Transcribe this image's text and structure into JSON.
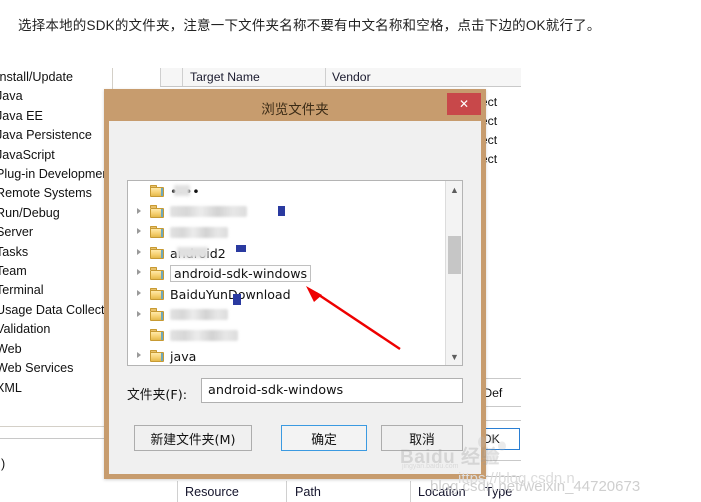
{
  "article": {
    "paragraph": "选择本地的SDK的文件夹，注意一下文件夹名称不要有中文名称和空格，点击下边的OK就行了。"
  },
  "eclipse": {
    "sidebar_items": [
      "Install/Update",
      "Java",
      "Java EE",
      "Java Persistence",
      "JavaScript",
      "Plug-in Development",
      "Remote Systems",
      "Run/Debug",
      "Server",
      "Tasks",
      "Team",
      "Terminal",
      "Usage Data Collector",
      "Validation",
      "Web",
      "Web Services",
      "XML"
    ],
    "sidebar_lower_glyph": ")",
    "table_headers": [
      "Target Name",
      "Vendor"
    ],
    "table_rows": [
      "ject",
      "ject",
      "ject",
      "ject"
    ],
    "restore_defaults_label": "ore Def",
    "ok_label": "OK",
    "bottom_headers": [
      "Resource",
      "Path",
      "Location",
      "Type"
    ]
  },
  "dialog": {
    "title": "浏览文件夹",
    "close_label": "✕",
    "folder_label": "文件夹(F):",
    "folder_value": "android-sdk-windows",
    "buttons": {
      "new_folder": "新建文件夹(M)",
      "ok": "确定",
      "cancel": "取消"
    },
    "tree": [
      {
        "label": "••••",
        "expandable": false,
        "blurred": "partial",
        "selected": false
      },
      {
        "label": "▒▒▒▒▒▒▒▒",
        "expandable": true,
        "blurred": "full",
        "selected": false
      },
      {
        "label": "▒▒▒▒▒▒",
        "expandable": true,
        "blurred": "full",
        "selected": false
      },
      {
        "label": "android2",
        "expandable": true,
        "blurred": "partial",
        "selected": false
      },
      {
        "label": "android-sdk-windows",
        "expandable": true,
        "blurred": "none",
        "selected": true
      },
      {
        "label": "BaiduYunDownload",
        "expandable": true,
        "blurred": "partial",
        "selected": false
      },
      {
        "label": "▒▒▒▒▒▒",
        "expandable": true,
        "blurred": "full",
        "selected": false
      },
      {
        "label": "▒▒▒▒▒▒▒",
        "expandable": false,
        "blurred": "full",
        "selected": false
      },
      {
        "label": "java",
        "expandable": true,
        "blurred": "none",
        "selected": false
      }
    ],
    "scrollbar": {
      "up": "▲",
      "down": "▼"
    }
  },
  "watermarks": {
    "baidu_main": "Baidu 经验",
    "baidu_sub": "jingyan.baidu.com",
    "csdn": "blog.csdn.net/weixin_44720673",
    "csdn_secondary": "ittps://blog.csdn.n"
  },
  "colors": {
    "dialog_border": "#c79c6e",
    "close_red": "#c8484a",
    "ok_focus_blue": "#3b9ae1",
    "arrow_red": "#ee0000"
  }
}
